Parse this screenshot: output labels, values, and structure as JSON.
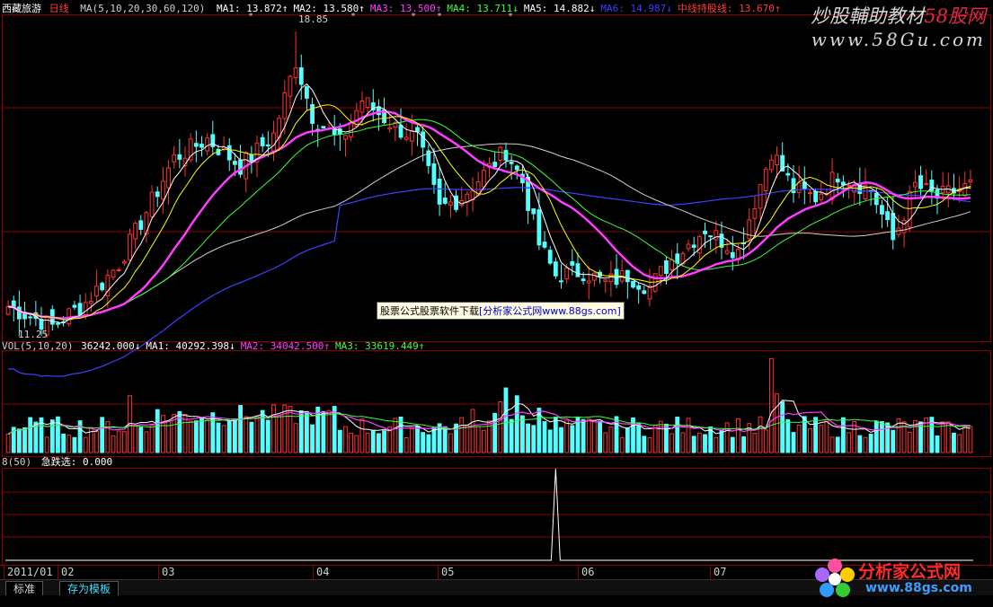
{
  "stock_name": "西藏旅游",
  "period": "日线",
  "main_legend": {
    "ma_params": "MA(5,10,20,30,60,120)",
    "items": [
      {
        "label": "MA1: 13.872",
        "arrow": "↑",
        "color": "#ffffff"
      },
      {
        "label": "MA2: 13.580",
        "arrow": "↑",
        "color": "#ffffff"
      },
      {
        "label": "MA3: 13.500",
        "arrow": "↑",
        "color": "#ff3cff"
      },
      {
        "label": "MA4: 13.711",
        "arrow": "↓",
        "color": "#3cff3c"
      },
      {
        "label": "MA5: 14.882",
        "arrow": "↓",
        "color": "#ffffff"
      },
      {
        "label": "MA6: 14.987",
        "arrow": "↓",
        "color": "#3c3cff"
      },
      {
        "label": "中线持股线: 13.670",
        "arrow": "↑",
        "color": "#ff3c3c"
      }
    ]
  },
  "price_high_label": "18.85",
  "price_low_label": "11.25",
  "vol_legend": {
    "params": "VOL(5,10,20)",
    "items": [
      {
        "label": "36242.000",
        "arrow": "↓",
        "color": "#ffffff"
      },
      {
        "label": "MA1: 40292.398",
        "arrow": "↓",
        "color": "#ffffff"
      },
      {
        "label": "MA2: 34042.500",
        "arrow": "↑",
        "color": "#ff3cff"
      },
      {
        "label": "MA3: 33619.449",
        "arrow": "↑",
        "color": "#3cff3c"
      }
    ]
  },
  "ind_legend": {
    "params": "8(50)",
    "label": "急跌选: 0.000"
  },
  "dates": [
    "2011/01",
    "02",
    "03",
    "04",
    "05",
    "06",
    "07"
  ],
  "watermark": {
    "title_a": "炒股輔助教材",
    "title_b": "58股网",
    "url": "www.58Gu.com"
  },
  "ad_banner": {
    "text": "股票公式股票软件下载",
    "link": "[分析家公式网www.88gs.com]"
  },
  "tabs": [
    {
      "label": "标准"
    },
    {
      "label": "存为模板"
    }
  ],
  "logo": {
    "name": "分析家公式网",
    "url": "www.88gs.com"
  },
  "colors": {
    "up": "#ff3232",
    "down": "#54ffff",
    "ma5": "#ffffff",
    "ma10": "#ffff00",
    "ma20": "#ff3cff",
    "ma30": "#3cff3c",
    "ma60": "#d0d0d0",
    "ma120": "#4040ff",
    "grid": "#8b0000"
  },
  "chart_data": {
    "type": "candlestick",
    "price_ylim": [
      11.0,
      19.2
    ],
    "vol_ylim": [
      0,
      100000
    ],
    "ind_ylim": [
      0,
      1
    ],
    "days": 175,
    "anchors": [
      [
        0,
        11.8
      ],
      [
        8,
        11.3
      ],
      [
        14,
        11.9
      ],
      [
        20,
        12.9
      ],
      [
        26,
        14.5
      ],
      [
        30,
        15.6
      ],
      [
        36,
        16.1
      ],
      [
        42,
        15.4
      ],
      [
        48,
        16.2
      ],
      [
        52,
        18.1
      ],
      [
        55,
        16.7
      ],
      [
        60,
        16.0
      ],
      [
        64,
        17.1
      ],
      [
        70,
        16.4
      ],
      [
        74,
        16.1
      ],
      [
        78,
        14.3
      ],
      [
        82,
        14.6
      ],
      [
        86,
        15.2
      ],
      [
        90,
        15.8
      ],
      [
        93,
        15.0
      ],
      [
        96,
        13.4
      ],
      [
        99,
        12.6
      ],
      [
        104,
        12.7
      ],
      [
        108,
        12.4
      ],
      [
        112,
        12.6
      ],
      [
        116,
        12.3
      ],
      [
        120,
        13.0
      ],
      [
        126,
        13.8
      ],
      [
        132,
        13.2
      ],
      [
        138,
        15.8
      ],
      [
        142,
        14.8
      ],
      [
        146,
        14.6
      ],
      [
        150,
        15.2
      ],
      [
        156,
        14.8
      ],
      [
        160,
        13.5
      ],
      [
        164,
        14.9
      ],
      [
        168,
        14.6
      ],
      [
        174,
        14.9
      ]
    ],
    "vol_spike_day": 138,
    "ind_spike_day": 99
  }
}
